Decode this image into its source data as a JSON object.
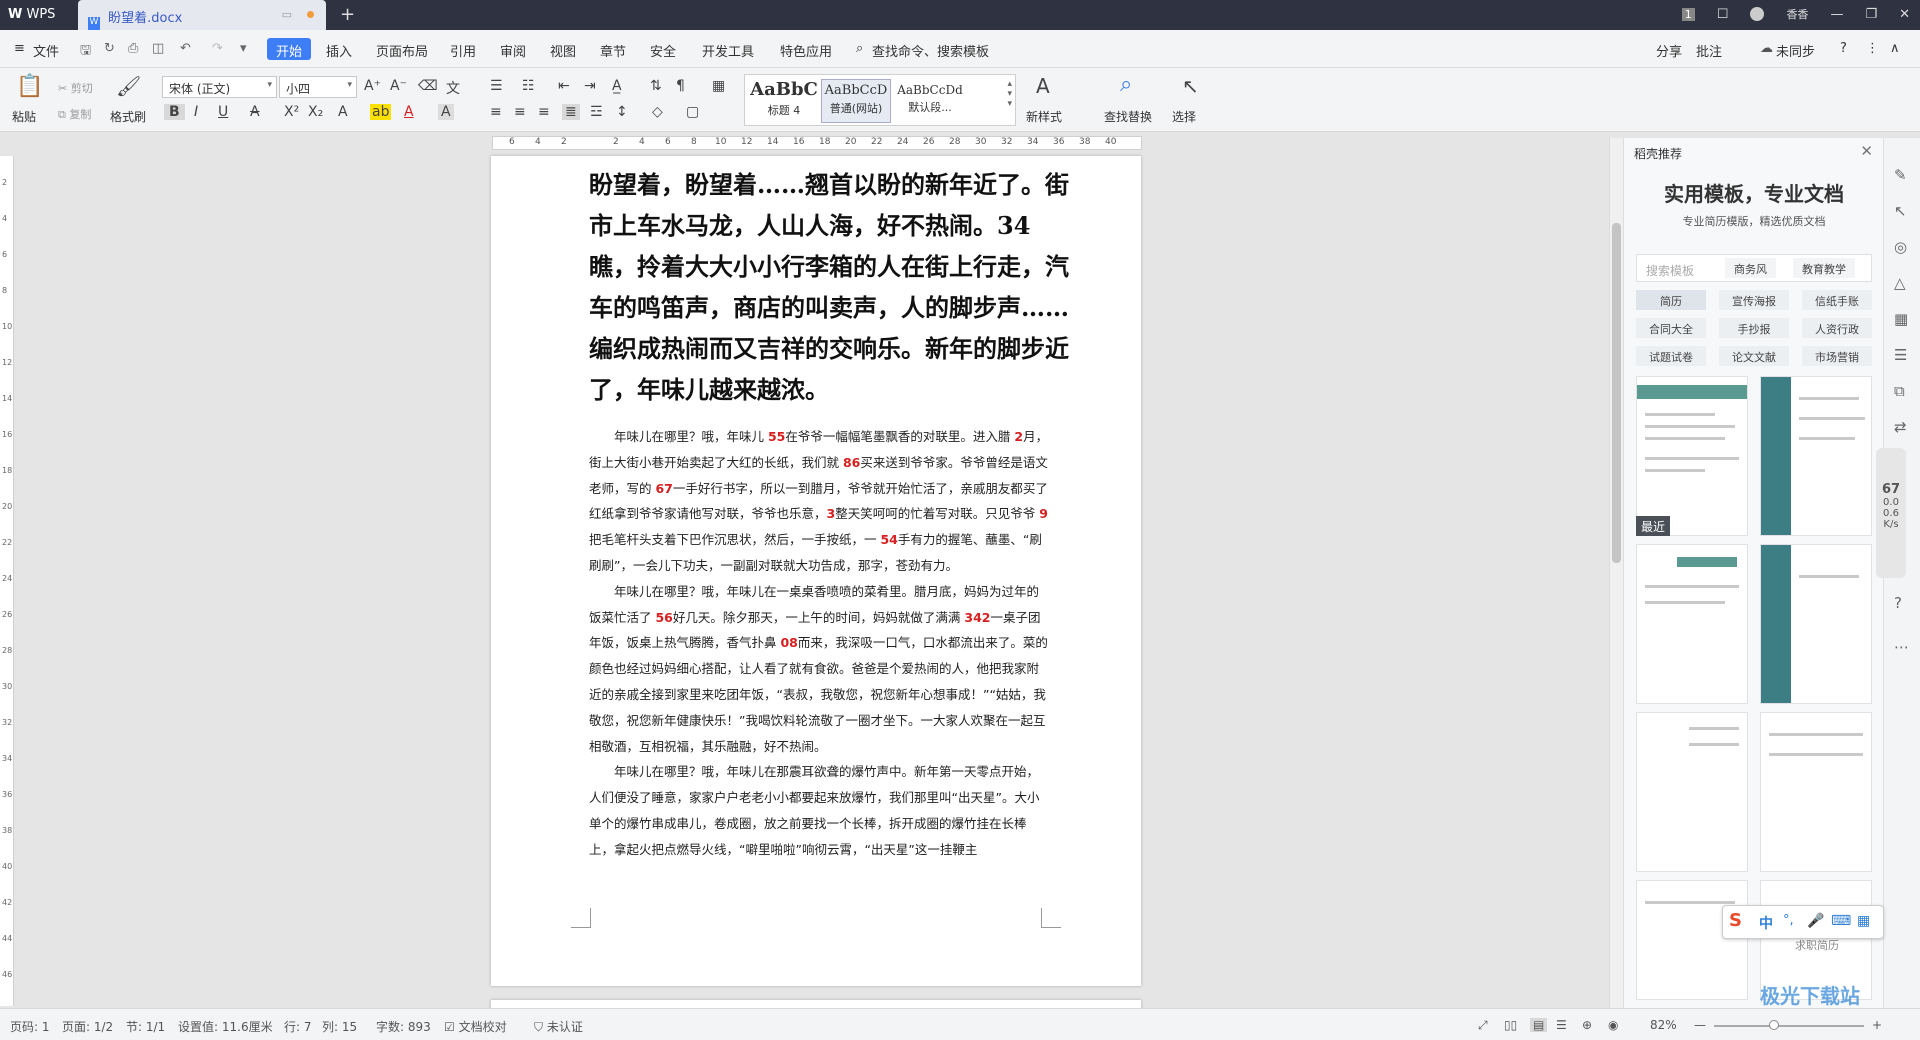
{
  "titlebar": {
    "app_name": "WPS",
    "doc_tab": "盼望着.docx",
    "new_tab_symbol": "+",
    "user_name": "香香",
    "badge": "1"
  },
  "menu": {
    "file": "文件",
    "start": "开始",
    "items": [
      "插入",
      "页面布局",
      "引用",
      "审阅",
      "视图",
      "章节",
      "安全",
      "开发工具",
      "特色应用"
    ],
    "search": "查找命令、搜索模板",
    "share": "分享",
    "annotate": "批注",
    "sync": "未同步",
    "help": "?"
  },
  "ribbon": {
    "paste": "粘贴",
    "cut": "剪切",
    "copy": "复制",
    "format_brush": "格式刷",
    "font_name": "宋体 (正文)",
    "font_size": "小四",
    "styles": [
      {
        "preview": "AaBbC",
        "label": "标题 4"
      },
      {
        "preview": "AaBbCcD",
        "label": "普通(网站)"
      },
      {
        "preview": "AaBbCcDd",
        "label": "默认段..."
      }
    ],
    "new_style": "新样式",
    "find_replace": "查找替换",
    "select": "选择"
  },
  "ruler": {
    "ticks": [
      "6",
      "4",
      "2",
      "",
      "2",
      "4",
      "6",
      "8",
      "10",
      "12",
      "14",
      "16",
      "18",
      "20",
      "22",
      "24",
      "26",
      "28",
      "30",
      "32",
      "34",
      "",
      "36",
      "38",
      "40"
    ],
    "vticks": [
      "2",
      "4",
      "6",
      "8",
      "10",
      "12",
      "14",
      "16",
      "18",
      "20",
      "22",
      "24",
      "26",
      "28",
      "30",
      "32",
      "34",
      "36",
      "38",
      "40",
      "42",
      "44",
      "46"
    ]
  },
  "document": {
    "heading": "盼望着，盼望着……翘首以盼的新年近了。街市上车水马龙，人山人海，好不热闹。34瞧，拎着大大小小行李箱的人在街上行走，汽车的鸣笛声，商店的叫卖声，人的脚步声……编织成热闹而又吉祥的交响乐。新年的脚步近了，年味儿越来越浓。",
    "paragraphs": [
      [
        {
          "t": "年味儿在哪里？哦，年味儿 "
        },
        {
          "t": "55",
          "hl": true
        },
        {
          "t": "在爷爷一幅幅笔墨飘香的对联里。进入腊 "
        },
        {
          "t": "2",
          "hl": true
        },
        {
          "t": "月，街上大街小巷开始卖起了大红的长纸，我们就 "
        },
        {
          "t": "86",
          "hl": true
        },
        {
          "t": "买来送到爷爷家。爷爷曾经是语文老师，写的 "
        },
        {
          "t": "67",
          "hl": true
        },
        {
          "t": "一手好行书字，所以一到腊月，爷爷就开始忙活了，亲戚朋友都买了红纸拿到爷爷家请他写对联，爷爷也乐意，"
        },
        {
          "t": "3",
          "hl": true
        },
        {
          "t": "整天笑呵呵的忙着写对联。只见爷爷 "
        },
        {
          "t": "9",
          "hl": true
        },
        {
          "t": "把毛笔杆头支着下巴作沉思状，然后，一手按纸，一 "
        },
        {
          "t": "54",
          "hl": true
        },
        {
          "t": "手有力的握笔、蘸墨、“刷刷刷”，一会儿下功夫，一副副对联就大功告成，那字，苍劲有力。"
        }
      ],
      [
        {
          "t": "年味儿在哪里？哦，年味儿在一桌桌香喷喷的菜肴里。腊月底，妈妈为过年的饭菜忙活了 "
        },
        {
          "t": "56",
          "hl": true
        },
        {
          "t": "好几天。除夕那天，一上午的时间，妈妈就做了满满 "
        },
        {
          "t": "342",
          "hl": true
        },
        {
          "t": "一桌子团年饭，饭桌上热气腾腾，香气扑鼻 "
        },
        {
          "t": "08",
          "hl": true
        },
        {
          "t": "而来，我深吸一口气，口水都流出来了。菜的颜色也经过妈妈细心搭配，让人看了就有食欲。爸爸是个爱热闹的人，他把我家附近的亲戚全接到家里来吃团年饭，“表叔，我敬您，祝您新年心想事成！”“姑姑，我敬您，祝您新年健康快乐！”我喝饮料轮流敬了一圈才坐下。一大家人欢聚在一起互相敬酒，互相祝福，其乐融融，好不热闹。"
        }
      ],
      [
        {
          "t": "年味儿在哪里？哦，年味儿在那震耳欲聋的爆竹声中。新年第一天零点开始，人们便没了睡意，家家户户老老小小都要起来放爆竹，我们那里叫“出天星”。大小单个的爆竹串成串儿，卷成圈，放之前要找一个长棒，拆开成圈的爆竹挂在长棒上，拿起火把点燃导火线，“噼里啪啦”响彻云霄，“出天星”这一挂鞭主"
        }
      ]
    ]
  },
  "panel": {
    "title": "稻壳推荐",
    "banner": "实用模板，专业文档",
    "subtitle": "专业简历模版，精选优质文档",
    "search_placeholder": "搜索模板",
    "search_tags": [
      "商务风",
      "教育教学"
    ],
    "categories": [
      "简历",
      "宣传海报",
      "信纸手账",
      "合同大全",
      "手抄报",
      "人资行政",
      "试题试卷",
      "论文文献",
      "市场营销"
    ],
    "recent": "最近",
    "card_text": "求职简历"
  },
  "speed": {
    "percent": "67",
    "up": "0.0",
    "down": "0.6",
    "unit": "K/s"
  },
  "ime": {
    "logo": "S",
    "mode": "中",
    "punct": "°,"
  },
  "status": {
    "page_code": "页码: 1",
    "page": "页面: 1/2",
    "section": "节: 1/1",
    "setting": "设置值: 11.6厘米",
    "row": "行: 7",
    "col": "列: 15",
    "words": "字数: 893",
    "proof": "文档校对",
    "auth": "未认证",
    "zoom": "82%"
  },
  "watermark": "极光下载站"
}
